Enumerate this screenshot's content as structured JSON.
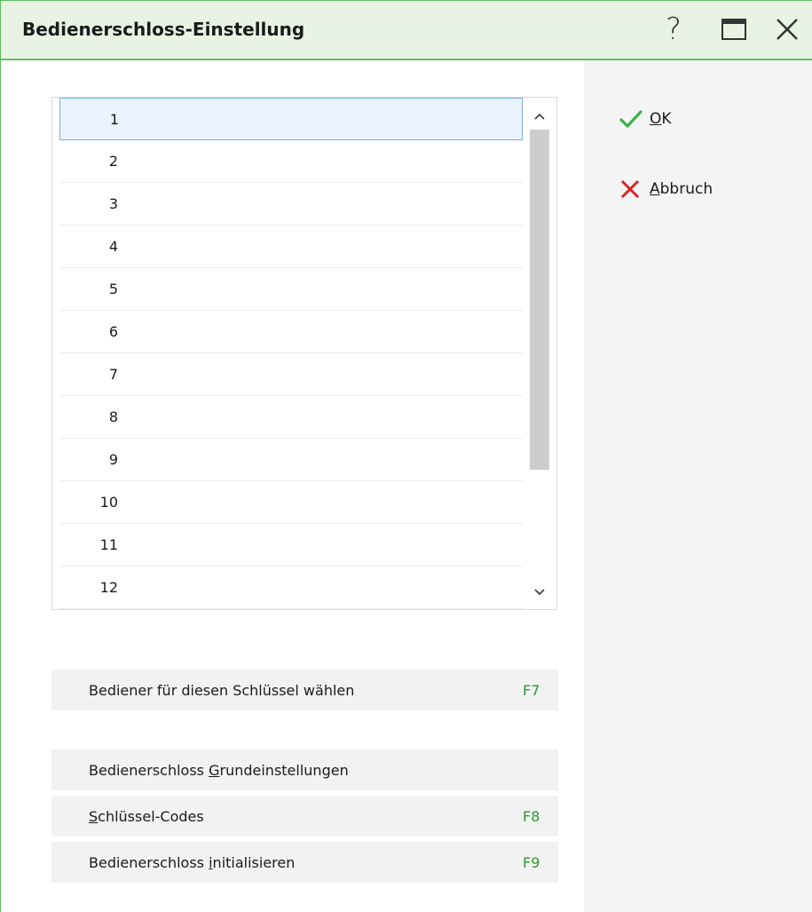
{
  "window": {
    "title": "Bedienerschloss-Einstellung",
    "help_label": "?"
  },
  "list": {
    "items": [
      "1",
      "2",
      "3",
      "4",
      "5",
      "6",
      "7",
      "8",
      "9",
      "10",
      "11",
      "12"
    ],
    "selected_index": 0
  },
  "actions": {
    "ok": {
      "mnemonic": "O",
      "rest": "K"
    },
    "cancel": {
      "mnemonic": "A",
      "rest": "bbruch"
    }
  },
  "buttons": {
    "choose_operator": {
      "label": "Bediener für diesen Schlüssel wählen",
      "key": "F7"
    },
    "basic_settings": {
      "before": "Bedienerschloss ",
      "mnemonic": "G",
      "after": "rundeinstellungen",
      "key": ""
    },
    "key_codes": {
      "before": "",
      "mnemonic": "S",
      "after": "chlüssel-Codes",
      "key": "F8"
    },
    "initialize": {
      "before": "Bedienerschloss ",
      "mnemonic": "i",
      "after": "nitialisieren",
      "key": "F9"
    }
  },
  "colors": {
    "accent_green": "#5fbf5f",
    "check_green": "#3cb043",
    "cancel_red": "#e02020",
    "fkey_green": "#2d9a2d",
    "selection_bg": "#eaf3fd",
    "selection_border": "#7aaee6"
  },
  "icons": {
    "ok": "checkmark-icon",
    "cancel": "x-icon",
    "maximize": "maximize-icon",
    "close": "close-icon",
    "scroll_up": "chevron-up-icon",
    "scroll_down": "chevron-down-icon"
  }
}
